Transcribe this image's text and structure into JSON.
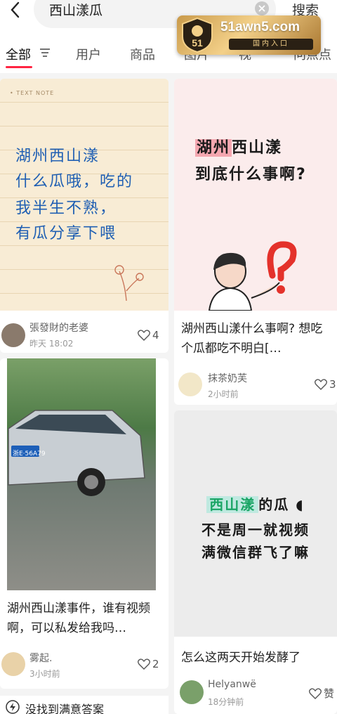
{
  "topbar": {
    "query": "西山漾瓜",
    "search_label": "搜索"
  },
  "tabs": [
    {
      "label": "全部"
    },
    {
      "label": "用户"
    },
    {
      "label": "商品"
    },
    {
      "label": "图片"
    },
    {
      "label": "视"
    },
    {
      "label": "问点点"
    }
  ],
  "badge": {
    "site": "51awn5.com",
    "sub": "国内入口",
    "shield": "51"
  },
  "cards": [
    {
      "tag": "• TEXT NOTE",
      "lines": [
        "湖州西山漾",
        "什么瓜哦，吃的",
        "我半生不熟，",
        "有瓜分享下喂"
      ],
      "author": "張發財的老婆",
      "time": "昨天 18:02",
      "likes": "4"
    },
    {
      "lines_hl": "湖州",
      "line1_rest": "西山漾",
      "line2": "到底什么事啊?",
      "title": "湖州西山漾什么事啊? 想吃个瓜都吃不明白[…",
      "author": "抹茶奶芙",
      "time": "2小时前",
      "likes": "3"
    },
    {
      "plate": "浙E·56A79",
      "title": "湖州西山漾事件，谁有视频啊，可以私发给我吗…",
      "author": "雾起.",
      "time": "3小时前",
      "likes": "2"
    },
    {
      "line1_hl": "西山漾",
      "line1_rest": "的瓜",
      "line2": "不是周一就视频",
      "line3": "满微信群飞了嘛",
      "title": "怎么这两天开始发酵了",
      "author": "Helyanwë",
      "time": "18分钟前",
      "likes": "赞"
    }
  ],
  "bottom": {
    "hint": "没找到满意答案"
  },
  "colors": {
    "accent": "#ff2442",
    "note_blue": "#1f5fb3",
    "badge_gold": "#f3d089"
  }
}
